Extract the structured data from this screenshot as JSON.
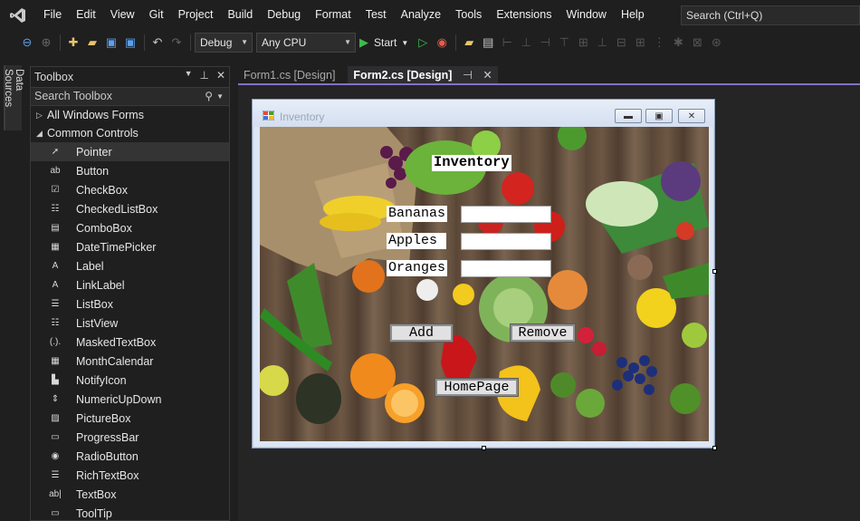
{
  "menu": {
    "items": [
      "File",
      "Edit",
      "View",
      "Git",
      "Project",
      "Build",
      "Debug",
      "Format",
      "Test",
      "Analyze",
      "Tools",
      "Extensions",
      "Window",
      "Help"
    ],
    "search_placeholder": "Search (Ctrl+Q)"
  },
  "toolbar": {
    "config": "Debug",
    "platform": "Any CPU",
    "start_label": "Start"
  },
  "side_tab": {
    "label": "Data Sources"
  },
  "toolbox": {
    "title": "Toolbox",
    "search_placeholder": "Search Toolbox",
    "groups": [
      {
        "label": "All Windows Forms",
        "expanded": false
      },
      {
        "label": "Common Controls",
        "expanded": true
      }
    ],
    "items": [
      {
        "label": "Pointer",
        "icon": "pointer-icon",
        "glyph": "➚"
      },
      {
        "label": "Button",
        "icon": "button-icon",
        "glyph": "ab"
      },
      {
        "label": "CheckBox",
        "icon": "checkbox-icon",
        "glyph": "☑"
      },
      {
        "label": "CheckedListBox",
        "icon": "checkedlistbox-icon",
        "glyph": "☷"
      },
      {
        "label": "ComboBox",
        "icon": "combobox-icon",
        "glyph": "▤"
      },
      {
        "label": "DateTimePicker",
        "icon": "datetimepicker-icon",
        "glyph": "▦"
      },
      {
        "label": "Label",
        "icon": "label-icon",
        "glyph": "A"
      },
      {
        "label": "LinkLabel",
        "icon": "linklabel-icon",
        "glyph": "A"
      },
      {
        "label": "ListBox",
        "icon": "listbox-icon",
        "glyph": "☰"
      },
      {
        "label": "ListView",
        "icon": "listview-icon",
        "glyph": "☷"
      },
      {
        "label": "MaskedTextBox",
        "icon": "maskedtextbox-icon",
        "glyph": "(.)."
      },
      {
        "label": "MonthCalendar",
        "icon": "monthcalendar-icon",
        "glyph": "▦"
      },
      {
        "label": "NotifyIcon",
        "icon": "notifyicon-icon",
        "glyph": "▙"
      },
      {
        "label": "NumericUpDown",
        "icon": "numericupdown-icon",
        "glyph": "⇕"
      },
      {
        "label": "PictureBox",
        "icon": "picturebox-icon",
        "glyph": "▨"
      },
      {
        "label": "ProgressBar",
        "icon": "progressbar-icon",
        "glyph": "▭"
      },
      {
        "label": "RadioButton",
        "icon": "radiobutton-icon",
        "glyph": "◉"
      },
      {
        "label": "RichTextBox",
        "icon": "richtextbox-icon",
        "glyph": "☰"
      },
      {
        "label": "TextBox",
        "icon": "textbox-icon",
        "glyph": "ab|"
      },
      {
        "label": "ToolTip",
        "icon": "tooltip-icon",
        "glyph": "▭"
      }
    ]
  },
  "tabs": [
    {
      "label": "Form1.cs [Design]",
      "active": false
    },
    {
      "label": "Form2.cs [Design]",
      "active": true
    }
  ],
  "form": {
    "title": "Inventory",
    "heading": "Inventory",
    "fields": [
      {
        "label": "Bananas",
        "value": ""
      },
      {
        "label": "Apples",
        "value": ""
      },
      {
        "label": "Oranges",
        "value": ""
      }
    ],
    "add_label": "Add",
    "remove_label": "Remove",
    "homepage_label": "HomePage"
  },
  "colors": {
    "accent": "#8570c9",
    "background": "#1f1f1f",
    "play_green": "#3fb950"
  }
}
